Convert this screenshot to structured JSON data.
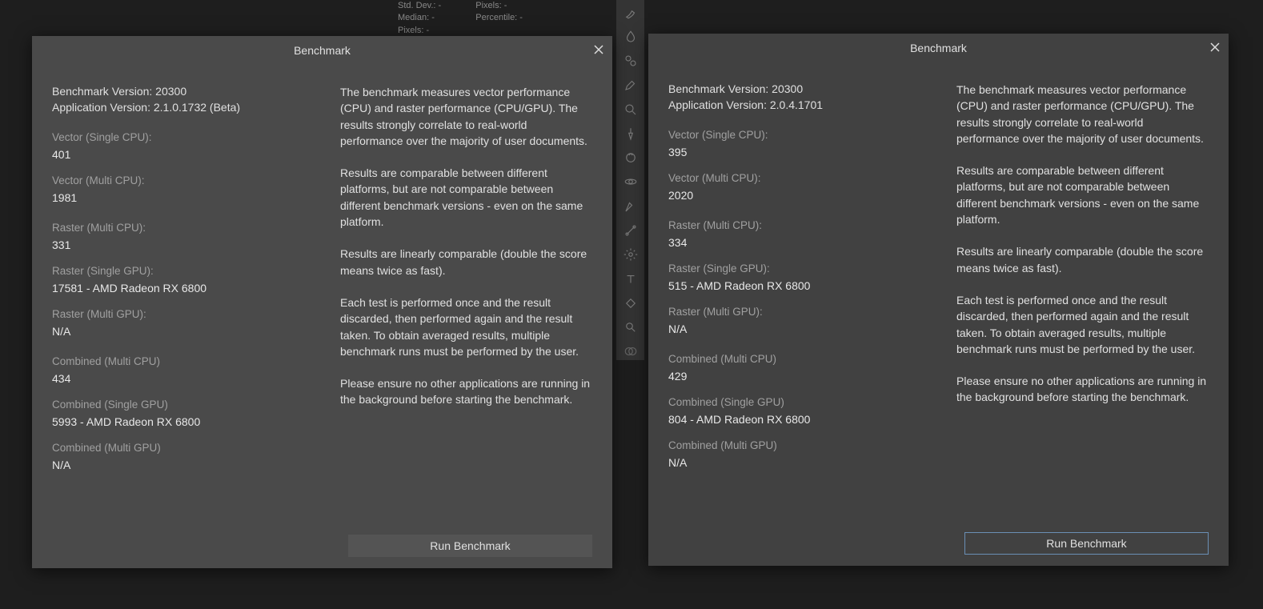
{
  "bg_stats": {
    "c1r1": "Std. Dev.: -",
    "c1r2": "Median: -",
    "c1r3": "Pixels: -",
    "c2r1": "Pixels: -",
    "c2r2": "Percentile: -"
  },
  "dialog_title": "Benchmark",
  "description": {
    "p1": "The benchmark measures vector performance (CPU) and raster performance (CPU/GPU). The results strongly correlate to real-world performance over the majority of user documents.",
    "p2": "Results are comparable between different platforms, but are not comparable between different benchmark versions - even on the same platform.",
    "p3": "Results are linearly comparable (double the score means twice as fast).",
    "p4": "Each test is performed once and the result discarded, then performed again and the result taken. To obtain averaged results, multiple benchmark runs must be performed by the user.",
    "p5": "Please ensure no other applications are running in the background before starting the benchmark."
  },
  "run_button_label": "Run Benchmark",
  "labels": {
    "vector_single": "Vector (Single CPU):",
    "vector_multi": "Vector (Multi CPU):",
    "raster_multi": "Raster (Multi CPU):",
    "raster_single_gpu": "Raster (Single GPU):",
    "raster_multi_gpu": "Raster (Multi GPU):",
    "combined_multi": "Combined (Multi CPU)",
    "combined_single_gpu": "Combined (Single GPU)",
    "combined_multi_gpu": "Combined (Multi GPU)"
  },
  "left": {
    "benchmark_version": "Benchmark Version: 20300",
    "app_version": "Application Version: 2.1.0.1732 (Beta)",
    "vector_single": "401",
    "vector_multi": "1981",
    "raster_multi": "331",
    "raster_single_gpu": "17581 - AMD Radeon RX 6800",
    "raster_multi_gpu": "N/A",
    "combined_multi": "434",
    "combined_single_gpu": "5993 - AMD Radeon RX 6800",
    "combined_multi_gpu": "N/A"
  },
  "right": {
    "benchmark_version": "Benchmark Version: 20300",
    "app_version": "Application Version: 2.0.4.1701",
    "vector_single": "395",
    "vector_multi": "2020",
    "raster_multi": "334",
    "raster_single_gpu": "515 - AMD Radeon RX 6800",
    "raster_multi_gpu": "N/A",
    "combined_multi": "429",
    "combined_single_gpu": "804 - AMD Radeon RX 6800",
    "combined_multi_gpu": "N/A"
  }
}
